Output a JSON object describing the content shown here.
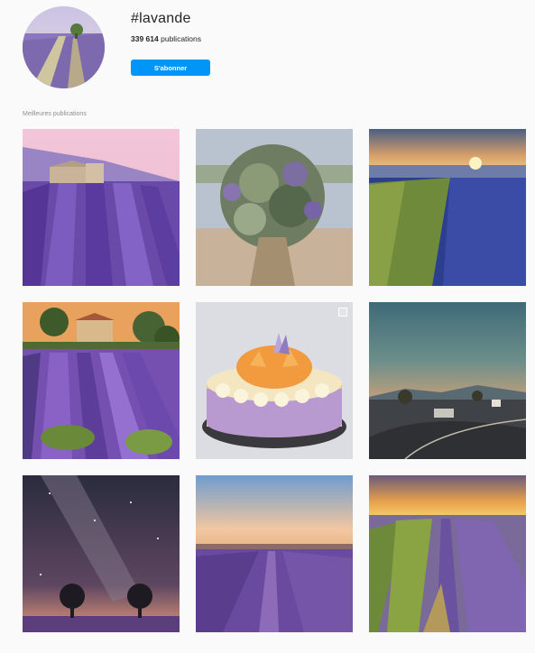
{
  "header": {
    "hashtag": "#lavande",
    "count_value": "339 614",
    "count_label": "publications",
    "follow_label": "S'abonner"
  },
  "top_posts": {
    "label": "Meilleures publications"
  },
  "colors": {
    "accent": "#0095f6",
    "background": "#fafafa",
    "muted_text": "#8e8e8e"
  }
}
